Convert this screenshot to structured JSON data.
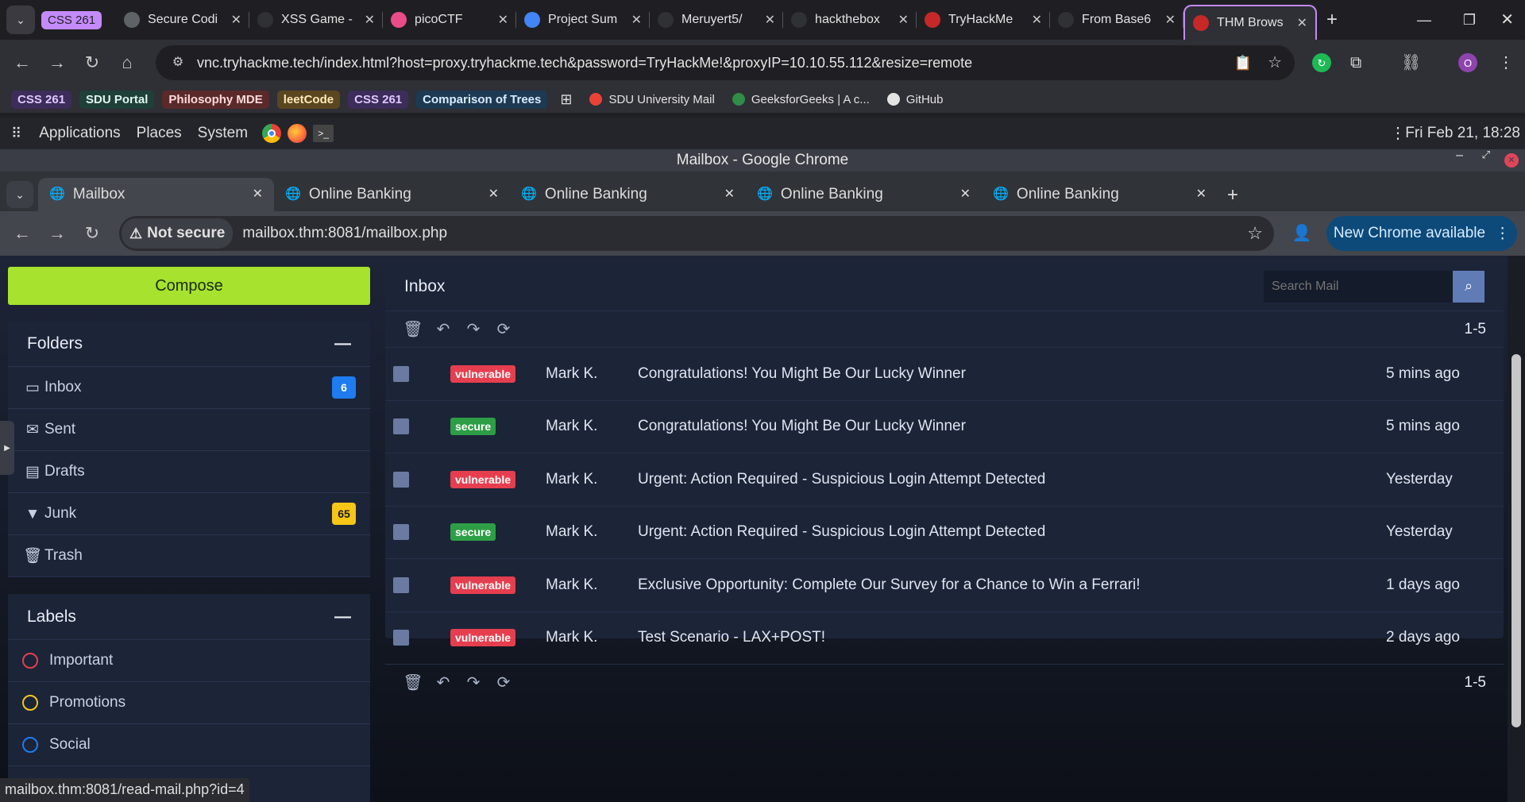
{
  "outer_browser": {
    "tabs": [
      {
        "label": "Secure Codi",
        "icon": "globe-icon",
        "color": "#5f6368"
      },
      {
        "label": "XSS Game -",
        "icon": "xss-icon",
        "color": "#303134"
      },
      {
        "label": "picoCTF",
        "icon": "pico-icon",
        "color": "#ea4c89"
      },
      {
        "label": "Project Sum",
        "icon": "doc-icon",
        "color": "#4285f4"
      },
      {
        "label": "Meruyert5/",
        "icon": "github-icon",
        "color": "#303134"
      },
      {
        "label": "hackthebox",
        "icon": "github-icon",
        "color": "#303134"
      },
      {
        "label": "TryHackMe",
        "icon": "thm-icon",
        "color": "#c62828"
      },
      {
        "label": "From Base6",
        "icon": "chef-icon",
        "color": "#303134"
      },
      {
        "label": "THM Brows",
        "icon": "thm-icon",
        "color": "#c62828",
        "active": true
      }
    ],
    "tab_group_label": "CSS 261",
    "url": "vnc.tryhackme.tech/index.html?host=proxy.tryhackme.tech&password=TryHackMe!&proxyIP=10.10.55.112&resize=remote",
    "profile_initial": "O",
    "bookmarks": [
      {
        "label": "CSS 261",
        "bg": "#3c2d5a",
        "fg": "#e0c8ff"
      },
      {
        "label": "SDU Portal",
        "bg": "#1f4038",
        "fg": "#dff5ee"
      },
      {
        "label": "Philosophy MDE",
        "bg": "#5a2a2a",
        "fg": "#ffd9d9"
      },
      {
        "label": "leetCode",
        "bg": "#5a4620",
        "fg": "#ffe9b8"
      },
      {
        "label": "CSS 261",
        "bg": "#3c2d5a",
        "fg": "#e0c8ff"
      },
      {
        "label": "Comparison of Trees",
        "bg": "#1e3a52",
        "fg": "#d8ecff"
      }
    ],
    "plain_bookmarks": [
      {
        "label": "SDU University Mail",
        "icon": "gmail-icon"
      },
      {
        "label": "GeeksforGeeks | A c...",
        "icon": "gfg-icon"
      },
      {
        "label": "GitHub",
        "icon": "github-icon"
      }
    ]
  },
  "desktop": {
    "menu": [
      "Applications",
      "Places",
      "System"
    ],
    "clock": "Fri Feb 21, 18:28",
    "window_title": "Mailbox - Google Chrome"
  },
  "inner_browser": {
    "tabs": [
      {
        "label": "Mailbox",
        "active": true
      },
      {
        "label": "Online Banking"
      },
      {
        "label": "Online Banking"
      },
      {
        "label": "Online Banking"
      },
      {
        "label": "Online Banking"
      }
    ],
    "security_label": "Not secure",
    "url": "mailbox.thm:8081/mailbox.php",
    "update_label": "New Chrome available",
    "status_url": "mailbox.thm:8081/read-mail.php?id=4"
  },
  "sidebar": {
    "compose_label": "Compose",
    "folders_title": "Folders",
    "folders": [
      {
        "label": "Inbox",
        "icon": "inbox-icon",
        "glyph": "▭",
        "badge": "6",
        "badge_bg": "#1e7bf0",
        "badge_fg": "#ffffff"
      },
      {
        "label": "Sent",
        "icon": "envelope-icon",
        "glyph": "✉"
      },
      {
        "label": "Drafts",
        "icon": "file-icon",
        "glyph": "▤"
      },
      {
        "label": "Junk",
        "icon": "filter-icon",
        "glyph": "▼",
        "badge": "65",
        "badge_bg": "#f5c518",
        "badge_fg": "#1a1a1a"
      },
      {
        "label": "Trash",
        "icon": "trash-icon",
        "glyph": "🗑"
      }
    ],
    "labels_title": "Labels",
    "labels": [
      {
        "label": "Important",
        "color": "#e53e4e"
      },
      {
        "label": "Promotions",
        "color": "#f5c518"
      },
      {
        "label": "Social",
        "color": "#1e7bf0"
      }
    ]
  },
  "inbox": {
    "title": "Inbox",
    "search_placeholder": "Search Mail",
    "range": "1-5",
    "messages": [
      {
        "tag": "vulnerable",
        "sender": "Mark K.",
        "subject": "Congratulations! You Might Be Our Lucky Winner",
        "time": "5 mins ago"
      },
      {
        "tag": "secure",
        "sender": "Mark K.",
        "subject": "Congratulations! You Might Be Our Lucky Winner",
        "time": "5 mins ago"
      },
      {
        "tag": "vulnerable",
        "sender": "Mark K.",
        "subject": "Urgent: Action Required - Suspicious Login Attempt Detected",
        "time": "Yesterday"
      },
      {
        "tag": "secure",
        "sender": "Mark K.",
        "subject": "Urgent: Action Required - Suspicious Login Attempt Detected",
        "time": "Yesterday"
      },
      {
        "tag": "vulnerable",
        "sender": "Mark K.",
        "subject": "Exclusive Opportunity: Complete Our Survey for a Chance to Win a Ferrari!",
        "time": "1 days ago"
      },
      {
        "tag": "vulnerable",
        "sender": "Mark K.",
        "subject": "Test Scenario - LAX+POST!",
        "time": "2 days ago"
      }
    ]
  }
}
